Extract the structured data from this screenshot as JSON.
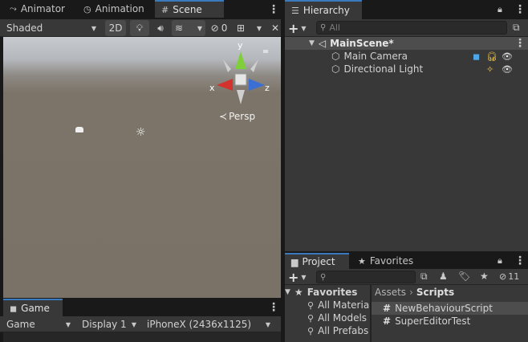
{
  "left_tabs": {
    "animator": "Animator",
    "animation": "Animation",
    "scene": "Scene"
  },
  "scene_toolbar": {
    "shading_mode": "Shaded",
    "mode_2d": "2D",
    "hidden_count": "0"
  },
  "scene_gizmo": {
    "axis_y": "y",
    "axis_x": "x",
    "axis_z": "z",
    "projection": "Persp"
  },
  "game_view": {
    "tab": "Game",
    "mode": "Game",
    "display": "Display 1",
    "resolution": "iPhoneX (2436x1125)"
  },
  "hierarchy": {
    "tab": "Hierarchy",
    "search_placeholder": "All",
    "scene_name": "MainScene*",
    "items": [
      {
        "label": "Main Camera"
      },
      {
        "label": "Directional Light"
      }
    ]
  },
  "project": {
    "tab_project": "Project",
    "tab_favorites": "Favorites",
    "hidden_count": "11",
    "favorites_header": "Favorites",
    "favorites": [
      {
        "label": "All Materia"
      },
      {
        "label": "All Models"
      },
      {
        "label": "All Prefabs"
      }
    ],
    "breadcrumb": [
      "Assets",
      "Scripts"
    ],
    "assets": [
      {
        "label": "NewBehaviourScript"
      },
      {
        "label": "SuperEditorTest"
      }
    ]
  },
  "colors": {
    "panel": "#383838",
    "tab_bar": "#191919",
    "scene_sky": "#b8bcc2",
    "scene_ground": "#7c7468",
    "selection": "#4d4d4d",
    "accent": "#3a79bb"
  }
}
